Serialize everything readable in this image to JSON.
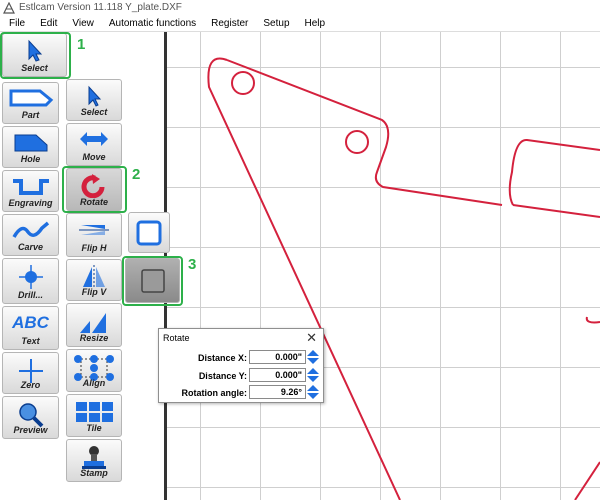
{
  "app": {
    "title": "Estlcam Version 11.118 Y_plate.DXF"
  },
  "menu": [
    "File",
    "Edit",
    "View",
    "Automatic functions",
    "Register",
    "Setup",
    "Help"
  ],
  "toolbar": {
    "select_main": "Select",
    "col1": [
      "Part",
      "Hole",
      "Engraving",
      "Carve",
      "Drill...",
      "Text",
      "Zero",
      "Preview"
    ],
    "col2": [
      "Select",
      "Move",
      "Rotate",
      "Flip H",
      "Flip V",
      "Resize",
      "Align",
      "Tile",
      "Stamp"
    ]
  },
  "annotations": [
    "1",
    "2",
    "3"
  ],
  "dialog": {
    "title": "Rotate",
    "close": "✕",
    "fields": [
      {
        "label": "Distance X:",
        "value": "0.000\""
      },
      {
        "label": "Distance Y:",
        "value": "0.000\""
      },
      {
        "label": "Rotation angle:",
        "value": "9.26°"
      }
    ]
  },
  "colors": {
    "accent": "#1f6fe0",
    "part_outline": "#d4213d",
    "highlight": "#2db04a"
  }
}
